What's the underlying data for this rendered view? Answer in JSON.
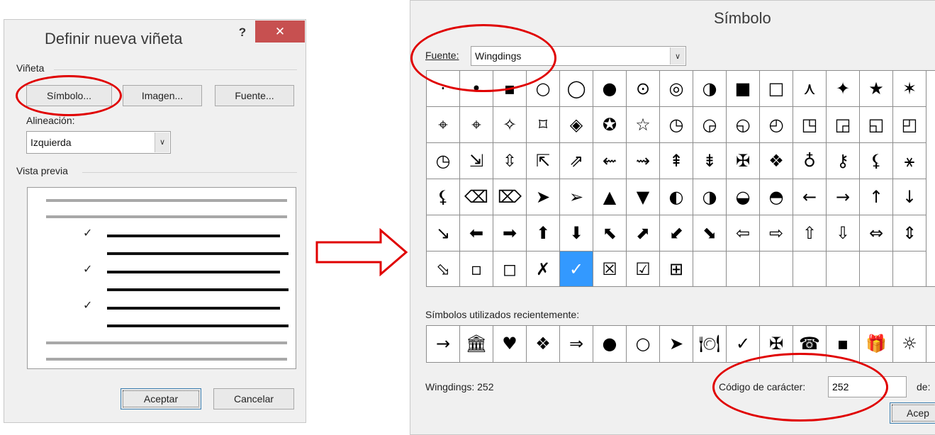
{
  "left_dialog": {
    "title": "Definir nueva viñeta",
    "help": "?",
    "close": "✕",
    "group_bullet": "Viñeta",
    "btn_symbol": "Símbolo...",
    "btn_image": "Imagen...",
    "btn_font": "Fuente...",
    "alignment_label": "Alineación:",
    "alignment_value": "Izquierda",
    "preview_label": "Vista previa",
    "check": "✓",
    "ok": "Aceptar",
    "cancel": "Cancelar"
  },
  "right_dialog": {
    "title": "Símbolo",
    "font_label": "Fuente:",
    "font_value": "Wingdings",
    "grid_rows": [
      [
        "·",
        "•",
        "▪",
        "○",
        "◯",
        "●",
        "⊙",
        "◎",
        "◑",
        "■",
        "□",
        "⋏",
        "✦",
        "★",
        "✶"
      ],
      [
        "⌖",
        "⌖",
        "✧",
        "⌑",
        "◈",
        "✪",
        "☆",
        "◷",
        "◶",
        "◵",
        "◴",
        "◳",
        "◲",
        "◱",
        "◰"
      ],
      [
        "◷",
        "⇲",
        "⇳",
        "⇱",
        "⇗",
        "⇜",
        "⇝",
        "⇞",
        "⇟",
        "✠",
        "❖",
        "♁",
        "⚷",
        "⚸",
        "⚹"
      ],
      [
        "⚸",
        "⌫",
        "⌦",
        "➤",
        "➢",
        "▲",
        "▼",
        "◐",
        "◑",
        "◒",
        "◓",
        "←",
        "→",
        "↑",
        "↓"
      ],
      [
        "↘",
        "⬅",
        "➡",
        "⬆",
        "⬇",
        "⬉",
        "⬈",
        "⬋",
        "⬊",
        "⇦",
        "⇨",
        "⇧",
        "⇩",
        "⇔",
        "⇕"
      ],
      [
        "⬂",
        "▫",
        "◻",
        "✗",
        "✓",
        "☒",
        "☑",
        "⊞",
        "",
        "",
        "",
        "",
        "",
        "",
        ""
      ]
    ],
    "recent_label": "Símbolos utilizados recientemente:",
    "recent": [
      "→",
      "🏛",
      "♥",
      "❖",
      "⇒",
      "●",
      "○",
      "➤",
      "🍽",
      "✓",
      "✠",
      "☎",
      "▪",
      "🎁",
      "☼"
    ],
    "status": "Wingdings: 252",
    "code_label": "Código de carácter:",
    "code_value": "252",
    "from_label": "de:",
    "ok_partial": "Acep"
  },
  "colors": {
    "dialog_bg": "#f0f0f0",
    "close_red": "#c75050",
    "selection_blue": "#3399ff",
    "annotation_red": "#e00000"
  }
}
